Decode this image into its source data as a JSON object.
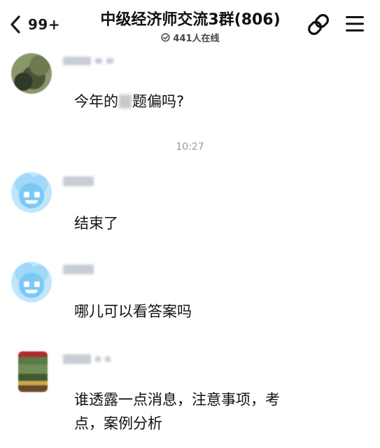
{
  "header": {
    "back_count": "99+",
    "title": "中级经济师交流3群(806)",
    "online": "441人在线"
  },
  "time_divider": "10:27",
  "messages": [
    {
      "text_before": "今年的",
      "text_after": "题偏吗?"
    },
    {
      "text": "结束了"
    },
    {
      "text": "哪儿可以看答案吗"
    },
    {
      "line1": "谁透露一点消息，注意事项，考",
      "line2": "点，案例分析"
    }
  ],
  "colors": {
    "text": "#111111",
    "timestamp": "#9a9a9a",
    "blurred_name": "#c8cdd6"
  },
  "icons": [
    "back-chevron-icon",
    "online-clock-icon",
    "group-link-icon",
    "menu-icon"
  ]
}
